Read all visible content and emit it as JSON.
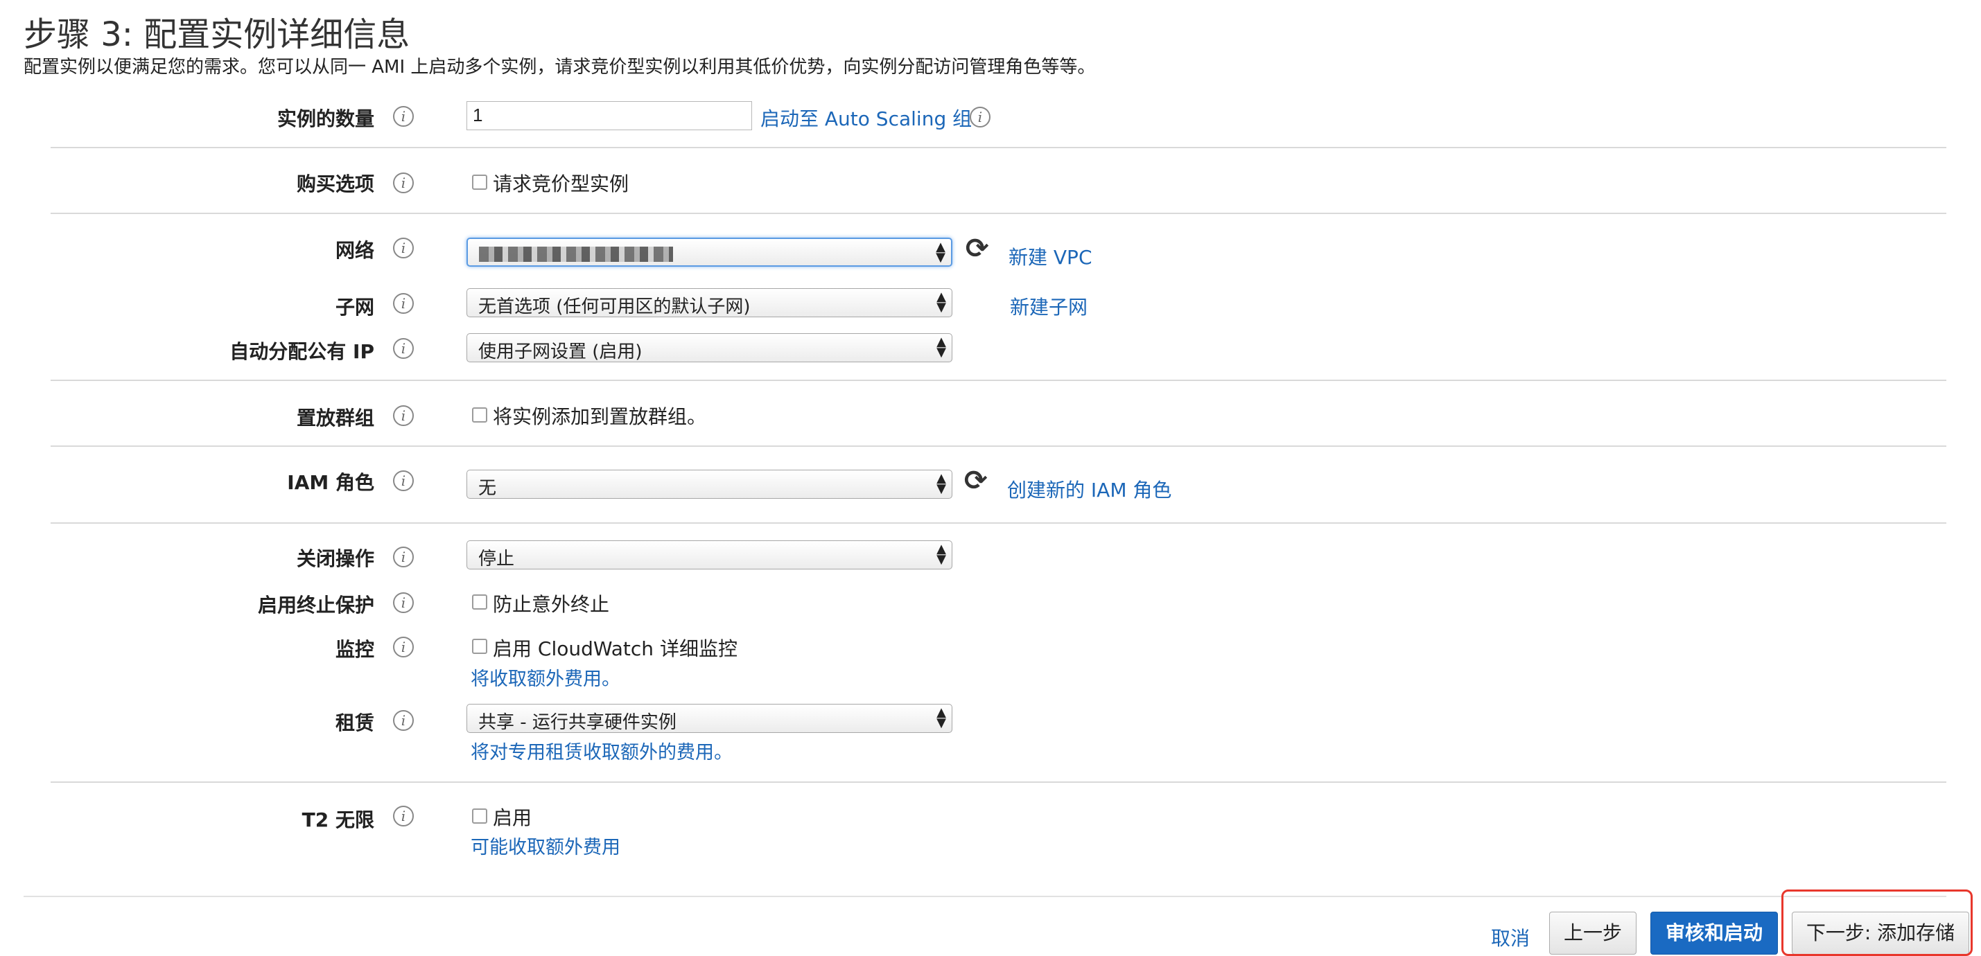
{
  "header": {
    "title": "步骤 3: 配置实例详细信息",
    "subtitle": "配置实例以便满足您的需求。您可以从同一 AMI 上启动多个实例，请求竞价型实例以利用其低价优势，向实例分配访问管理角色等等。"
  },
  "info_icon_glyph": "i",
  "fields": {
    "instance_count": {
      "label": "实例的数量",
      "value": "1",
      "link": "启动至 Auto Scaling 组"
    },
    "purchase": {
      "label": "购买选项",
      "checkbox": "请求竞价型实例"
    },
    "network": {
      "label": "网络",
      "value": "",
      "link": "新建 VPC"
    },
    "subnet": {
      "label": "子网",
      "value": "无首选项 (任何可用区的默认子网)",
      "link": "新建子网"
    },
    "public_ip": {
      "label": "自动分配公有 IP",
      "value": "使用子网设置 (启用)"
    },
    "placement": {
      "label": "置放群组",
      "checkbox": "将实例添加到置放群组。"
    },
    "iam": {
      "label": "IAM 角色",
      "value": "无",
      "link": "创建新的 IAM 角色"
    },
    "shutdown": {
      "label": "关闭操作",
      "value": "停止"
    },
    "termination": {
      "label": "启用终止保护",
      "checkbox": "防止意外终止"
    },
    "monitoring": {
      "label": "监控",
      "checkbox": "启用 CloudWatch 详细监控",
      "note": "将收取额外费用。"
    },
    "tenancy": {
      "label": "租赁",
      "value": "共享 - 运行共享硬件实例",
      "note": "将对专用租赁收取额外的费用。"
    },
    "t2": {
      "label": "T2 无限",
      "checkbox": "启用",
      "note": "可能收取额外费用"
    }
  },
  "footer": {
    "cancel": "取消",
    "previous": "上一步",
    "review_launch": "审核和启动",
    "next": "下一步: 添加存储"
  },
  "colors": {
    "link": "#1c67b8",
    "primary_button": "#1a6ac2",
    "highlight": "#e8372c"
  },
  "icons": {
    "info": "info-circle-icon",
    "refresh": "refresh-icon",
    "select_arrows": "updown-arrows-icon"
  }
}
